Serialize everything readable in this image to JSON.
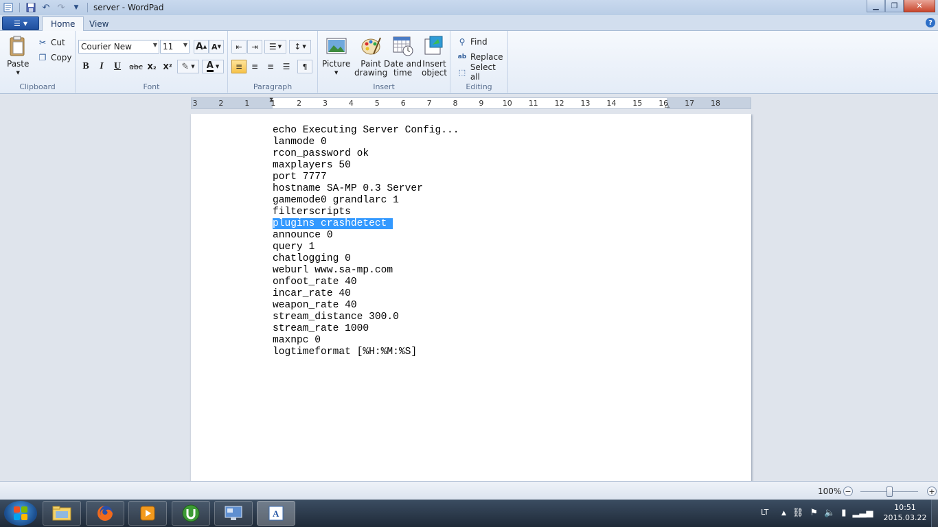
{
  "window": {
    "title": "server - WordPad"
  },
  "tabs": [
    {
      "label": "Home"
    },
    {
      "label": "View"
    }
  ],
  "ribbon": {
    "clipboard": {
      "label": "Clipboard",
      "paste": "Paste",
      "cut": "Cut",
      "copy": "Copy"
    },
    "font": {
      "label": "Font",
      "family": "Courier New",
      "size": "11",
      "bold": "B",
      "italic": "I",
      "underline": "U",
      "strike": "abc",
      "subscript": "X₂",
      "superscript": "X²",
      "grow": "A",
      "shrink": "A"
    },
    "paragraph": {
      "label": "Paragraph"
    },
    "insert": {
      "label": "Insert",
      "picture": "Picture",
      "paint_1": "Paint",
      "paint_2": "drawing",
      "datetime_1": "Date and",
      "datetime_2": "time",
      "object_1": "Insert",
      "object_2": "object"
    },
    "editing": {
      "label": "Editing",
      "find": "Find",
      "replace": "Replace",
      "select_all": "Select all"
    }
  },
  "ruler": {
    "ticks": [
      "3",
      "2",
      "1",
      "1",
      "2",
      "3",
      "4",
      "5",
      "6",
      "7",
      "8",
      "9",
      "10",
      "11",
      "12",
      "13",
      "14",
      "15",
      "16",
      "17",
      "18"
    ]
  },
  "document": {
    "lines": [
      "echo Executing Server Config...",
      "lanmode 0",
      "rcon_password ok",
      "maxplayers 50",
      "port 7777",
      "hostname SA-MP 0.3 Server",
      "gamemode0 grandlarc 1",
      "filterscripts",
      "plugins crashdetect",
      "announce 0",
      "query 1",
      "chatlogging 0",
      "weburl www.sa-mp.com",
      "onfoot_rate 40",
      "incar_rate 40",
      "weapon_rate 40",
      "stream_distance 300.0",
      "stream_rate 1000",
      "maxnpc 0",
      "logtimeformat [%H:%M:%S]"
    ],
    "selected_line_index": 8
  },
  "statusbar": {
    "zoom": "100%",
    "zoom_minus": "−",
    "zoom_plus": "+"
  },
  "taskbar": {
    "tray_lang": "LT",
    "clock_time": "10:51",
    "clock_date": "2015.03.22"
  },
  "colors": {
    "selection": "#3399ff",
    "accent": "#1f4f9e"
  }
}
